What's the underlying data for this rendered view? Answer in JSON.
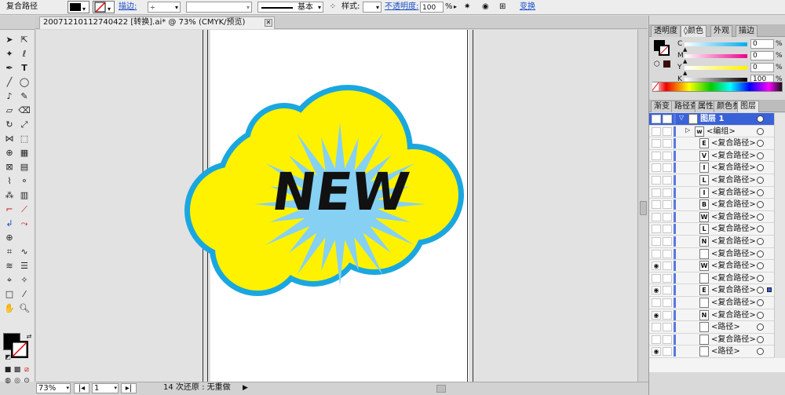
{
  "control_bar": {
    "selection_type": "复合路径",
    "stroke_label": "描边:",
    "stroke_profile": "基本",
    "style_label": "样式:",
    "opacity_label": "不透明度:",
    "opacity_value": "100",
    "opacity_unit": "%",
    "transform_label": "变换"
  },
  "document_tab": {
    "title": "20071210112740422 [转换].ai* @ 73% (CMYK/预览)",
    "close": "✕"
  },
  "status_bar": {
    "zoom": "73%",
    "artboard": "1",
    "undo_status": "14 次还原 : 无重做"
  },
  "artwork": {
    "text": "NEW",
    "colors": {
      "cloud_fill": "#fff200",
      "cloud_stroke": "#1aa7e0",
      "burst": "#86d0f4",
      "text": "#111111"
    }
  },
  "color_panel": {
    "tabs": [
      "透明度",
      "◊颜色",
      "外观",
      "描边"
    ],
    "active_tab": 1,
    "sliders": [
      {
        "label": "C",
        "value": "0",
        "unit": "%",
        "level": 0
      },
      {
        "label": "M",
        "value": "0",
        "unit": "%",
        "level": 0
      },
      {
        "label": "Y",
        "value": "0",
        "unit": "%",
        "level": 0
      },
      {
        "label": "K",
        "value": "100",
        "unit": "%",
        "level": 100
      }
    ]
  },
  "layers_panel": {
    "tabs": [
      "渐变",
      "路径查",
      "属性",
      "颜色参",
      "图层"
    ],
    "active_tab": 4,
    "rows": [
      {
        "name": "图层 1",
        "type": "layer",
        "eye": true,
        "thumb": "▪",
        "target": true
      },
      {
        "name": "<编组>",
        "type": "group",
        "eye": false,
        "thumb": "w",
        "target": true
      },
      {
        "name": "<复合路径>",
        "type": "item",
        "eye": false,
        "thumb": "E",
        "target": true
      },
      {
        "name": "<复合路径>",
        "type": "item",
        "eye": false,
        "thumb": "V",
        "target": true
      },
      {
        "name": "<复合路径>",
        "type": "item",
        "eye": false,
        "thumb": "I",
        "target": true
      },
      {
        "name": "<复合路径>",
        "type": "item",
        "eye": false,
        "thumb": "L",
        "target": true
      },
      {
        "name": "<复合路径>",
        "type": "item",
        "eye": false,
        "thumb": "I",
        "target": true
      },
      {
        "name": "<复合路径>",
        "type": "item",
        "eye": false,
        "thumb": "B",
        "target": true
      },
      {
        "name": "<复合路径>",
        "type": "item",
        "eye": false,
        "thumb": "W",
        "target": true
      },
      {
        "name": "<复合路径>",
        "type": "item",
        "eye": false,
        "thumb": "L",
        "target": true
      },
      {
        "name": "<复合路径>",
        "type": "item",
        "eye": false,
        "thumb": "N",
        "target": true
      },
      {
        "name": "<复合路径>",
        "type": "item",
        "eye": false,
        "thumb": "",
        "target": true
      },
      {
        "name": "<复合路径>",
        "type": "item",
        "eye": true,
        "thumb": "W",
        "target": true
      },
      {
        "name": "<复合路径>",
        "type": "item",
        "eye": false,
        "thumb": "",
        "target": true
      },
      {
        "name": "<复合路径>",
        "type": "item",
        "eye": true,
        "thumb": "E",
        "target": true,
        "selected": true
      },
      {
        "name": "<复合路径>",
        "type": "item",
        "eye": false,
        "thumb": "",
        "target": true
      },
      {
        "name": "<复合路径>",
        "type": "item",
        "eye": true,
        "thumb": "N",
        "target": true
      },
      {
        "name": "<路径>",
        "type": "item",
        "eye": false,
        "thumb": "",
        "target": true
      },
      {
        "name": "<复合路径>",
        "type": "item",
        "eye": false,
        "thumb": "",
        "target": true
      },
      {
        "name": "<路径>",
        "type": "item",
        "eye": true,
        "thumb": "",
        "target": true
      }
    ]
  }
}
